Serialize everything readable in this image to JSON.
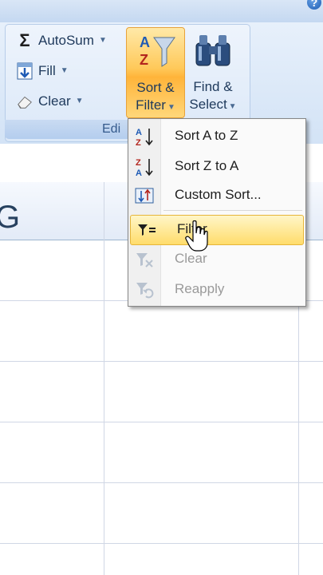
{
  "ribbon": {
    "help_glyph": "?",
    "group_label": "Editing",
    "group_label_visible": "Edi",
    "autosum": {
      "icon": "sigma-icon",
      "label": "AutoSum"
    },
    "fill": {
      "icon": "fill-down-icon",
      "label": "Fill"
    },
    "clear": {
      "icon": "eraser-icon",
      "label": "Clear"
    },
    "sort_filter": {
      "icon": "sort-filter-icon",
      "line1": "Sort &",
      "line2": "Filter"
    },
    "find_select": {
      "icon": "binoculars-icon",
      "line1": "Find &",
      "line2": "Select"
    }
  },
  "sheet": {
    "column_label": "G"
  },
  "menu": {
    "items": [
      {
        "label": "Sort A to Z",
        "icon": "sort-a-z-icon",
        "enabled": true
      },
      {
        "label": "Sort Z to A",
        "icon": "sort-z-a-icon",
        "enabled": true
      },
      {
        "label": "Custom Sort...",
        "icon": "custom-sort-icon",
        "enabled": true
      },
      {
        "label": "Filter",
        "icon": "filter-icon",
        "enabled": true,
        "highlighted": true
      },
      {
        "label": "Clear",
        "icon": "clear-filter-icon",
        "enabled": false
      },
      {
        "label": "Reapply",
        "icon": "reapply-filter-icon",
        "enabled": false
      }
    ]
  },
  "colors": {
    "accent_orange": "#ffc95a",
    "ribbon_blue": "#d3e3f6",
    "text_dark": "#1e395b"
  }
}
